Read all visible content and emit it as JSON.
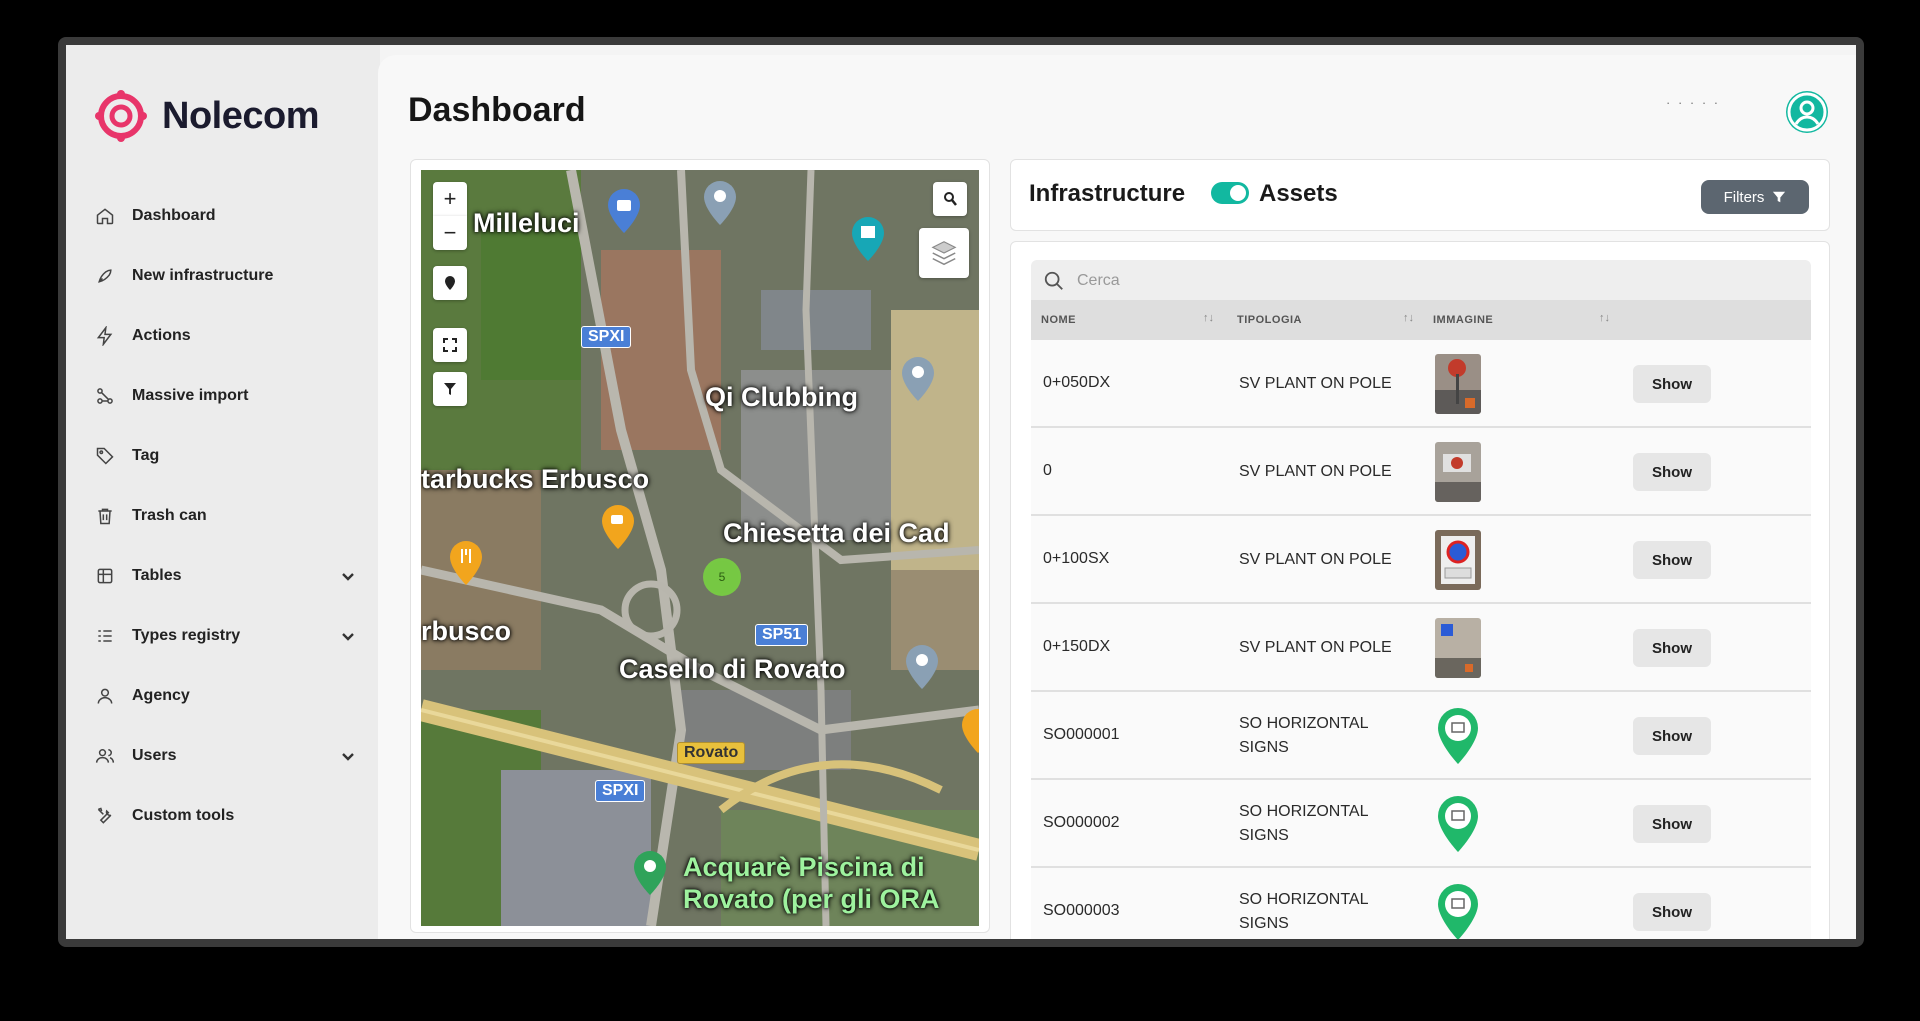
{
  "brand": {
    "name": "Nolecom",
    "color": "#e8356a",
    "accent": "#12b8a0"
  },
  "sidebar": {
    "items": [
      {
        "label": "Dashboard",
        "icon": "home-icon"
      },
      {
        "label": "New infrastructure",
        "icon": "rocket-icon"
      },
      {
        "label": "Actions",
        "icon": "lightning-icon"
      },
      {
        "label": "Massive import",
        "icon": "import-icon"
      },
      {
        "label": "Tag",
        "icon": "tag-icon"
      },
      {
        "label": "Trash can",
        "icon": "trash-icon"
      },
      {
        "label": "Tables",
        "icon": "table-icon",
        "expandable": true
      },
      {
        "label": "Types registry",
        "icon": "list-icon",
        "expandable": true
      },
      {
        "label": "Agency",
        "icon": "person-icon"
      },
      {
        "label": "Users",
        "icon": "users-icon",
        "expandable": true
      },
      {
        "label": "Custom tools",
        "icon": "tools-icon"
      }
    ]
  },
  "header": {
    "title": "Dashboard",
    "user_dots": "· · · · ·"
  },
  "map": {
    "labels": [
      "Milleluci",
      "Qi Clubbing",
      "tarbucks Erbusco",
      "Chiesetta dei Cad",
      "rbusco",
      "Casello di Rovato",
      "Acquarè Piscina di",
      "Rovato (per gli ORA"
    ],
    "roads": [
      "SPXI",
      "SP51",
      "Rovato",
      "SPXI"
    ],
    "cluster_count": "5",
    "zoom_in": "+",
    "zoom_out": "−"
  },
  "toggle": {
    "left_label": "Infrastructure",
    "right_label": "Assets",
    "checked": true
  },
  "filters_label": "Filters",
  "search": {
    "placeholder": "Cerca"
  },
  "table": {
    "columns": [
      "NOME",
      "TIPOLOGIA",
      "IMMAGINE"
    ],
    "rows": [
      {
        "nome": "0+050DX",
        "tipologia": "SV PLANT ON POLE",
        "image": "photo",
        "action": "Show"
      },
      {
        "nome": "0",
        "tipologia": "SV PLANT ON POLE",
        "image": "photo",
        "action": "Show"
      },
      {
        "nome": "0+100SX",
        "tipologia": "SV PLANT ON POLE",
        "image": "photo",
        "action": "Show"
      },
      {
        "nome": "0+150DX",
        "tipologia": "SV PLANT ON POLE",
        "image": "photo",
        "action": "Show"
      },
      {
        "nome": "SO000001",
        "tipologia": "SO HORIZONTAL SIGNS",
        "image": "green-pin",
        "action": "Show"
      },
      {
        "nome": "SO000002",
        "tipologia": "SO HORIZONTAL SIGNS",
        "image": "green-pin",
        "action": "Show"
      },
      {
        "nome": "SO000003",
        "tipologia": "SO HORIZONTAL SIGNS",
        "image": "green-pin",
        "action": "Show"
      }
    ]
  }
}
